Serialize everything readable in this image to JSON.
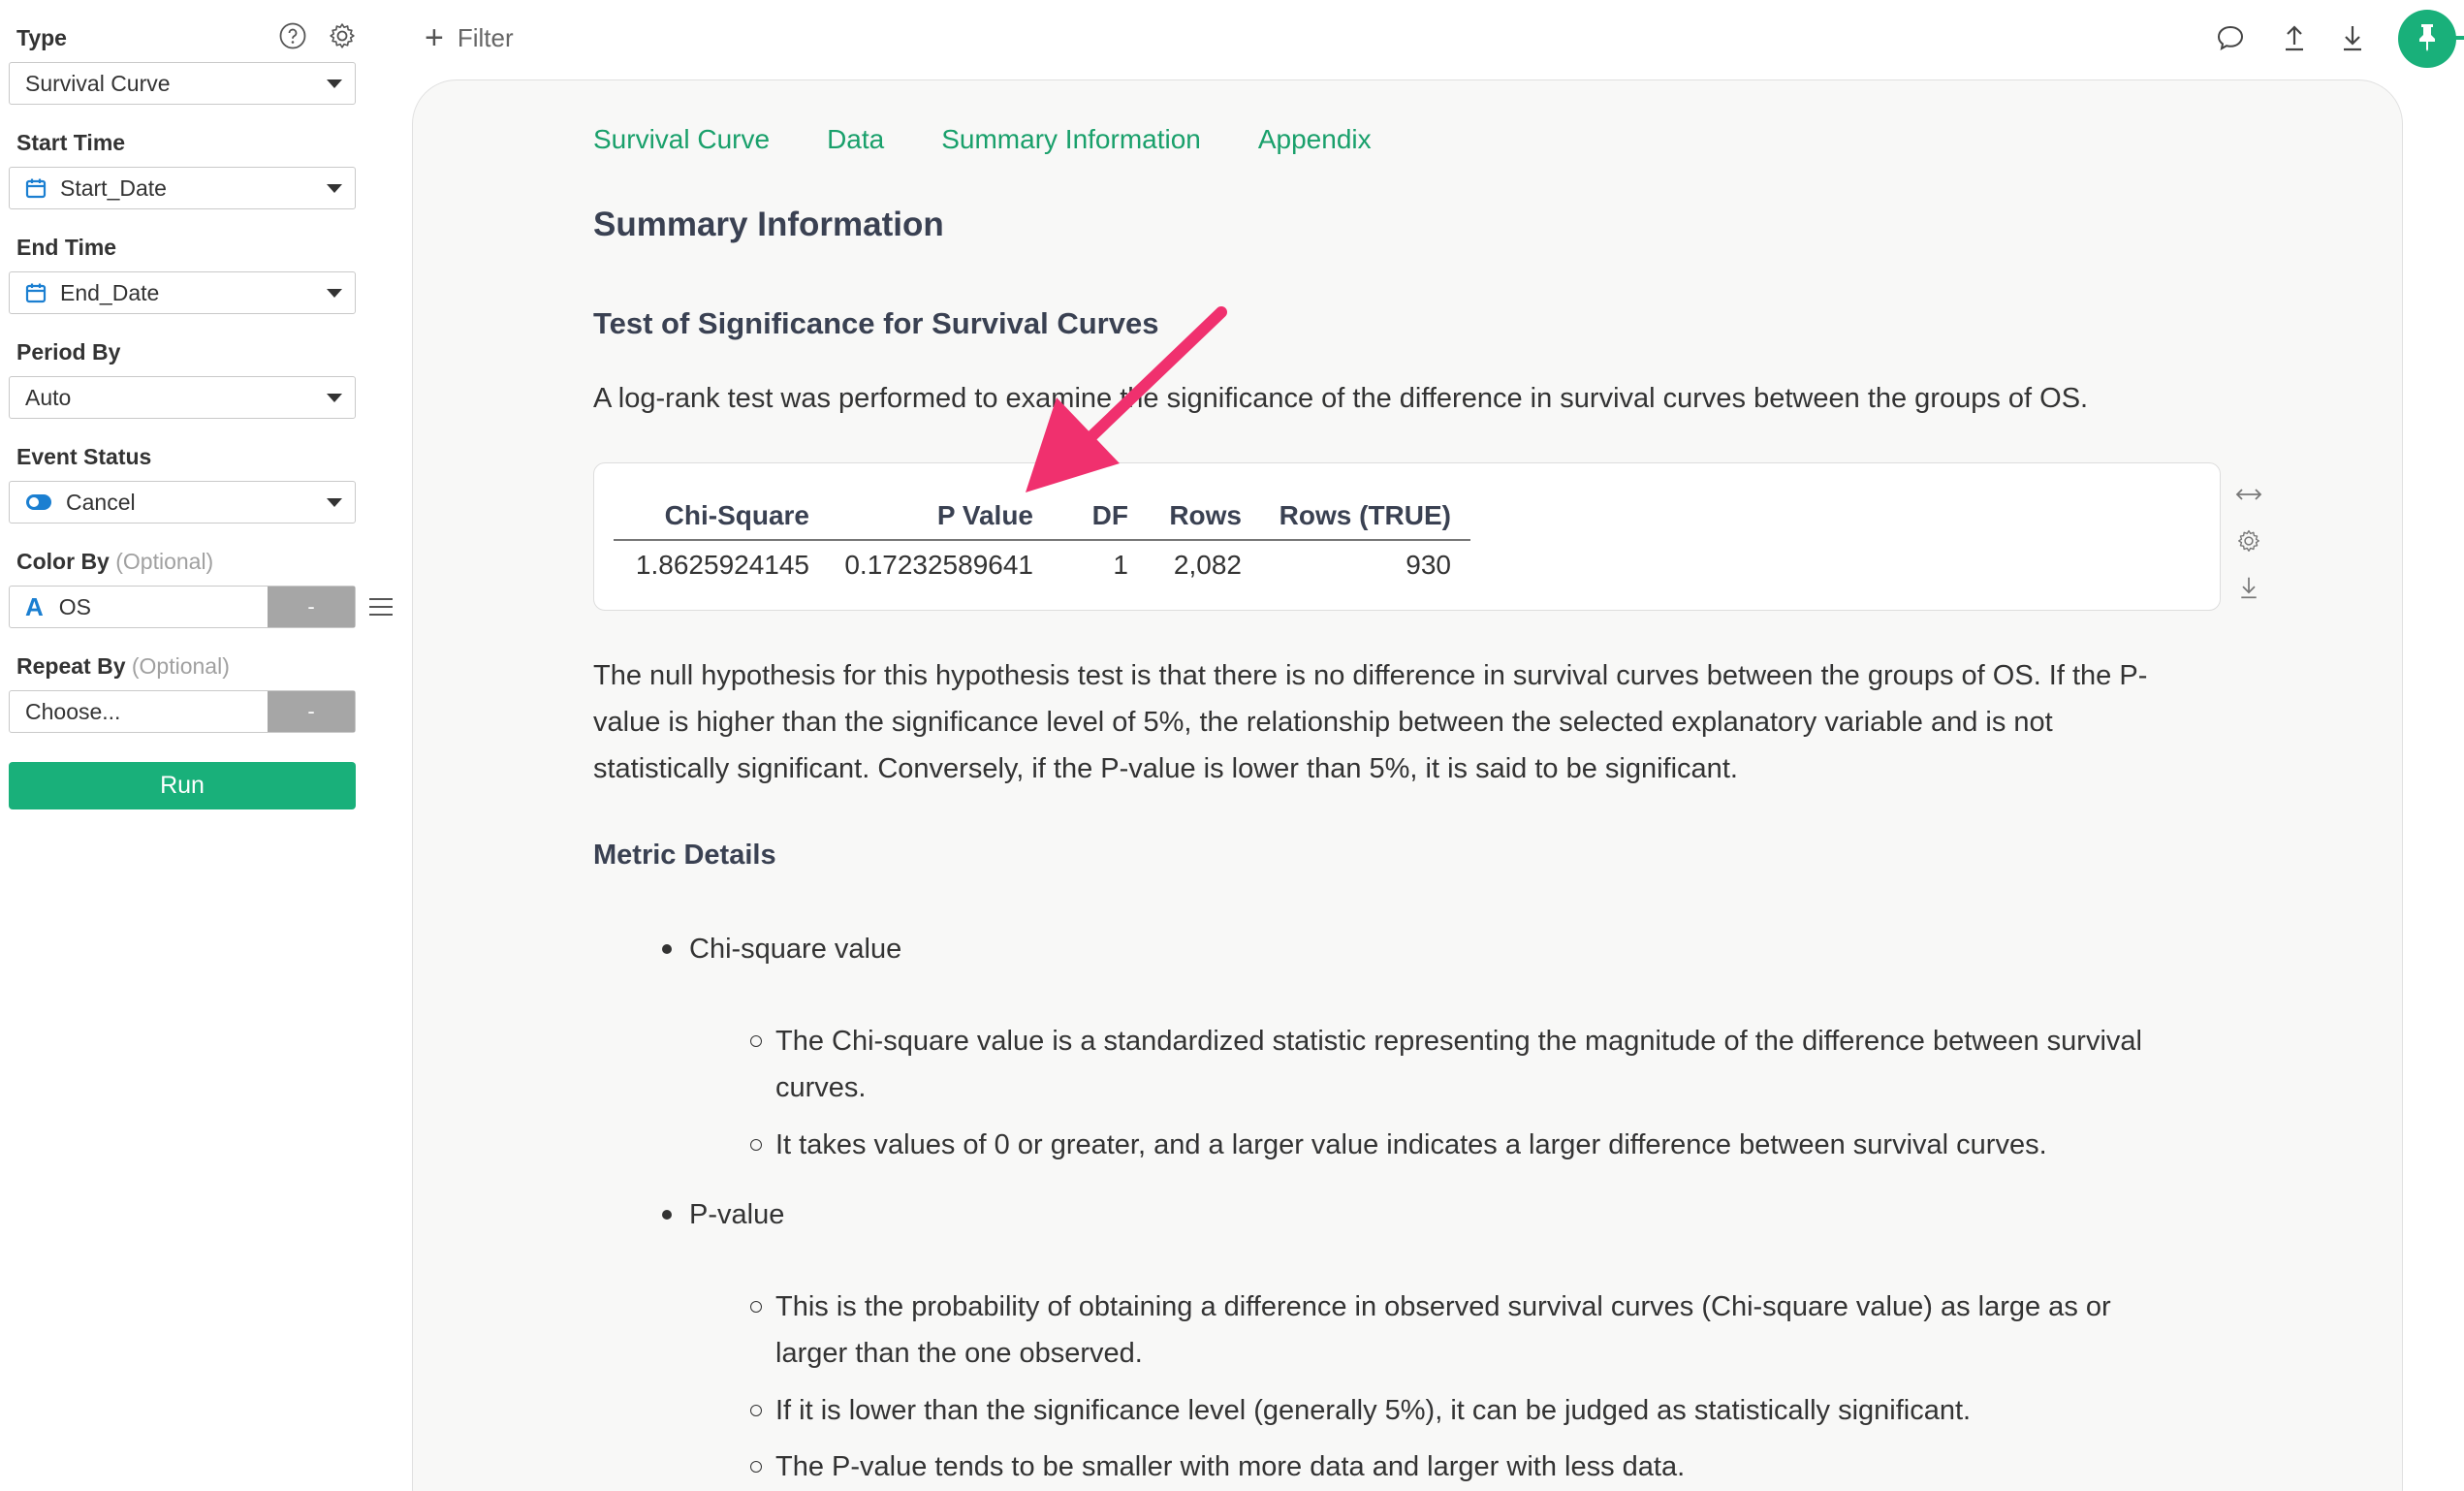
{
  "sidebar": {
    "type_label": "Type",
    "type_value": "Survival Curve",
    "start_time_label": "Start Time",
    "start_time_value": "Start_Date",
    "end_time_label": "End Time",
    "end_time_value": "End_Date",
    "period_by_label": "Period By",
    "period_by_value": "Auto",
    "event_status_label": "Event Status",
    "event_status_value": "Cancel",
    "color_by_label": "Color By",
    "color_by_optional": "(Optional)",
    "color_by_value": "OS",
    "color_by_type_glyph": "A",
    "repeat_by_label": "Repeat By",
    "repeat_by_optional": "(Optional)",
    "repeat_by_placeholder": "Choose...",
    "dash": "-",
    "run_label": "Run"
  },
  "topbar": {
    "filter_label": "Filter",
    "icons": [
      "comment-icon",
      "upload-icon",
      "download-icon",
      "pin-icon"
    ]
  },
  "tabs": [
    "Survival Curve",
    "Data",
    "Summary Information",
    "Appendix"
  ],
  "content": {
    "title": "Summary Information",
    "section_title": "Test of Significance for Survival Curves",
    "intro": "A log-rank test was performed to examine the significance of the difference in survival curves between the groups of OS.",
    "table": {
      "headers": [
        "Chi-Square",
        "P Value",
        "DF",
        "Rows",
        "Rows (TRUE)"
      ],
      "row": [
        "1.8625924145",
        "0.17232589641",
        "1",
        "2,082",
        "930"
      ]
    },
    "null_hypothesis_lines": [
      "The null hypothesis for this hypothesis test is that there is no difference in survival curves between the groups of OS. If the P-",
      "value is higher than the significance level of 5%, the relationship between the selected explanatory variable and  is not",
      "statistically significant. Conversely, if the P-value is lower than 5%, it is said to be significant."
    ],
    "metric_title": "Metric Details",
    "chi_title": "Chi-square value",
    "chi_items": [
      [
        "The Chi-square value is a standardized statistic representing the magnitude of the difference between survival",
        "curves."
      ],
      [
        "It takes values of 0 or greater, and a larger value indicates a larger difference between survival curves."
      ]
    ],
    "p_title": "P-value",
    "p_items": [
      [
        "This is the probability of obtaining a difference in observed survival curves (Chi-square value) as large as or",
        "larger than the one observed."
      ],
      [
        "If it is lower than the significance level (generally 5%), it can be judged as statistically significant."
      ],
      [
        "The P-value tends to be smaller with more data and larger with less data."
      ]
    ]
  },
  "colors": {
    "accent": "#19b07a",
    "tab_text": "#19a06b",
    "annotation_arrow": "#f0306e",
    "heading": "#3a4152"
  }
}
